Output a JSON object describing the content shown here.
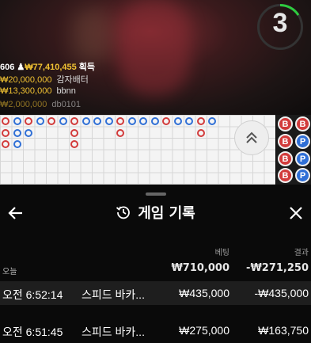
{
  "stream": {
    "timer": "3",
    "winners": {
      "total_prefix": "606 ",
      "total_icon": "person-icon",
      "total_amount": "₩77,410,455",
      "total_suffix": " 획득",
      "rows": [
        {
          "amount": "₩20,000,000",
          "name": "감자배터"
        },
        {
          "amount": "₩13,300,000",
          "name": "bbnn"
        },
        {
          "amount": "₩2,000,000",
          "name": "db0101"
        }
      ]
    }
  },
  "roadmap": {
    "colors": {
      "banker": "#d23b3b",
      "player": "#2f6fd6"
    },
    "big_road_letters": [
      "B",
      "B",
      "B",
      "P",
      "B",
      "P",
      "B",
      "P"
    ]
  },
  "history": {
    "title": "게임 기록",
    "col_bet": "베팅",
    "col_result": "결과",
    "today_label": "오늘",
    "today_bet": "₩710,000",
    "today_result": "-₩271,250",
    "rows": [
      {
        "time": "오전 6:52:14",
        "game": "스피드 바카...",
        "bet": "₩435,000",
        "result": "-₩435,000"
      },
      {
        "time": "오전 6:51:45",
        "game": "스피드 바카...",
        "bet": "₩275,000",
        "result": "₩163,750"
      }
    ]
  }
}
